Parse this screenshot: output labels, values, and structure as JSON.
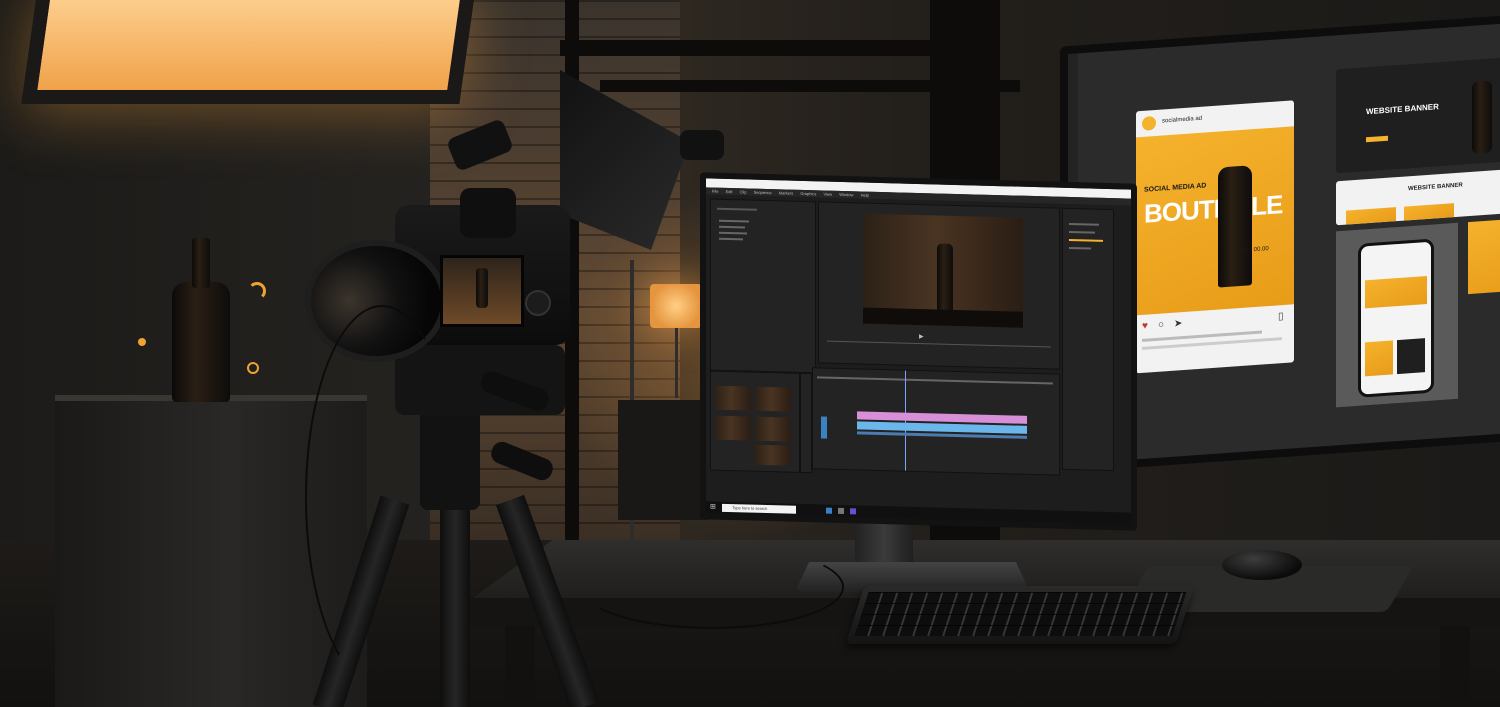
{
  "scene": {
    "description_free": true,
    "colors": {
      "accent": "#f5b22d",
      "timeline_pink": "#d78fd8",
      "timeline_blue": "#6bb6ea"
    }
  },
  "monitor": {
    "titlebar": "",
    "menu": [
      "File",
      "Edit",
      "Clip",
      "Sequence",
      "Markers",
      "Graphics",
      "View",
      "Window",
      "Help"
    ],
    "taskbar_search": "Type here to search"
  },
  "display": {
    "social_card": {
      "handle": "socialmedia ad",
      "overlay": "SOCIAL MEDIA AD",
      "headline": "BOUTEILLE",
      "price": "$0 / 00.00"
    },
    "banner": {
      "title": "WEBSITE BANNER",
      "subtitle": "WEBSITE BANNER"
    }
  },
  "icons": [
    "camera-icon",
    "bottle-icon",
    "windows-start-icon",
    "play-icon",
    "heart-icon",
    "comment-icon",
    "share-icon",
    "bookmark-icon"
  ]
}
